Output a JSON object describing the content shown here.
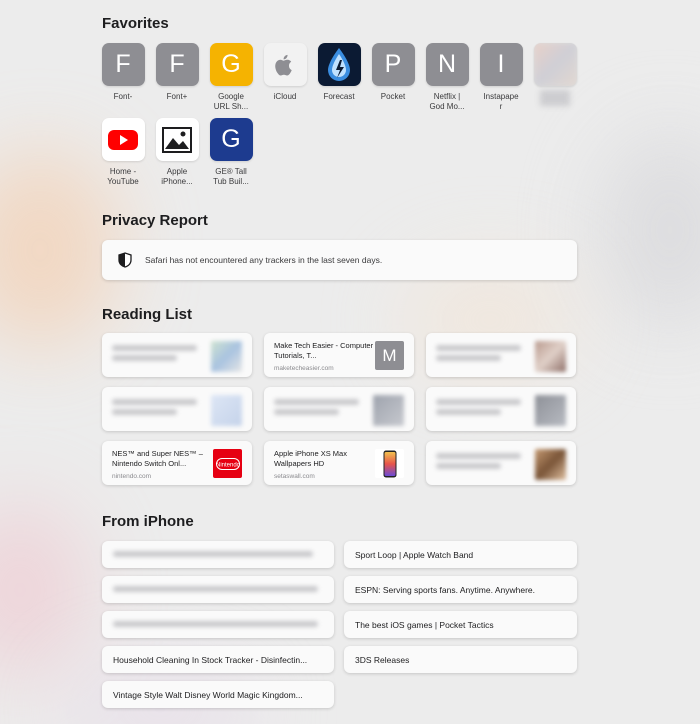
{
  "favorites": {
    "title": "Favorites",
    "items": [
      {
        "label": "Font-",
        "letter": "F",
        "color": "#8e8e93",
        "icon": "letter-icon"
      },
      {
        "label": "Font+",
        "letter": "F",
        "color": "#8e8e93",
        "icon": "letter-icon"
      },
      {
        "label": "Google\nURL Sh...",
        "letter": "G",
        "color": "#f5b301",
        "icon": "letter-icon"
      },
      {
        "label": "iCloud",
        "letter": "",
        "color": "#f2f2f2",
        "icon": "apple-logo-icon"
      },
      {
        "label": "Forecast",
        "letter": "",
        "color": "#0b1a33",
        "icon": "forecast-drop-icon"
      },
      {
        "label": "Pocket",
        "letter": "P",
        "color": "#8e8e93",
        "icon": "letter-icon"
      },
      {
        "label": "Netflix |\nGod Mo...",
        "letter": "N",
        "color": "#8e8e93",
        "icon": "letter-icon"
      },
      {
        "label": "Instapape\nr",
        "letter": "I",
        "color": "#8e8e93",
        "icon": "letter-icon"
      },
      {
        "label": "",
        "letter": "",
        "color": "#dddddd",
        "icon": "blurred-icon"
      },
      {
        "label": "Home -\nYouTube",
        "letter": "",
        "color": "#ffffff",
        "icon": "youtube-icon"
      },
      {
        "label": "Apple\niPhone...",
        "letter": "",
        "color": "#ffffff",
        "icon": "photo-icon"
      },
      {
        "label": "GE® Tall\nTub Buil...",
        "letter": "G",
        "color": "#1d3b8f",
        "icon": "letter-icon"
      }
    ]
  },
  "privacy": {
    "title": "Privacy Report",
    "message": "Safari has not encountered any trackers in the last seven days."
  },
  "reading_list": {
    "title": "Reading List",
    "items": [
      {
        "title": "",
        "domain": "",
        "blurred": true
      },
      {
        "title": "Make Tech Easier - Computer Tutorials, T...",
        "domain": "maketecheasier.com",
        "thumb_letter": "M",
        "thumb_color": "#8e8e93",
        "thumb_icon": "letter-icon"
      },
      {
        "title": "",
        "domain": "",
        "blurred": true
      },
      {
        "title": "",
        "domain": "",
        "blurred": true
      },
      {
        "title": "",
        "domain": "",
        "blurred": true
      },
      {
        "title": "",
        "domain": "",
        "blurred": true
      },
      {
        "title": "NES™ and Super NES™ – Nintendo Switch Onl...",
        "domain": "nintendo.com",
        "thumb_letter": "",
        "thumb_color": "#e60012",
        "thumb_icon": "nintendo-logo-icon"
      },
      {
        "title": "Apple iPhone XS Max Wallpapers HD",
        "domain": "setaswall.com",
        "thumb_letter": "",
        "thumb_color": "#ffffff",
        "thumb_icon": "phone-wallpaper-icon"
      },
      {
        "title": "",
        "domain": "",
        "blurred": true
      }
    ]
  },
  "from_iphone": {
    "title": "From iPhone",
    "left": [
      {
        "title": "",
        "blurred": true
      },
      {
        "title": "",
        "blurred": true
      },
      {
        "title": "",
        "blurred": true
      },
      {
        "title": "Household Cleaning In Stock Tracker - Disinfectin..."
      },
      {
        "title": "Vintage Style Walt Disney World Magic Kingdom..."
      }
    ],
    "right": [
      {
        "title": "Sport Loop | Apple Watch Band"
      },
      {
        "title": "ESPN: Serving sports fans. Anytime. Anywhere."
      },
      {
        "title": "The best iOS games | Pocket Tactics"
      },
      {
        "title": "3DS Releases"
      }
    ]
  }
}
